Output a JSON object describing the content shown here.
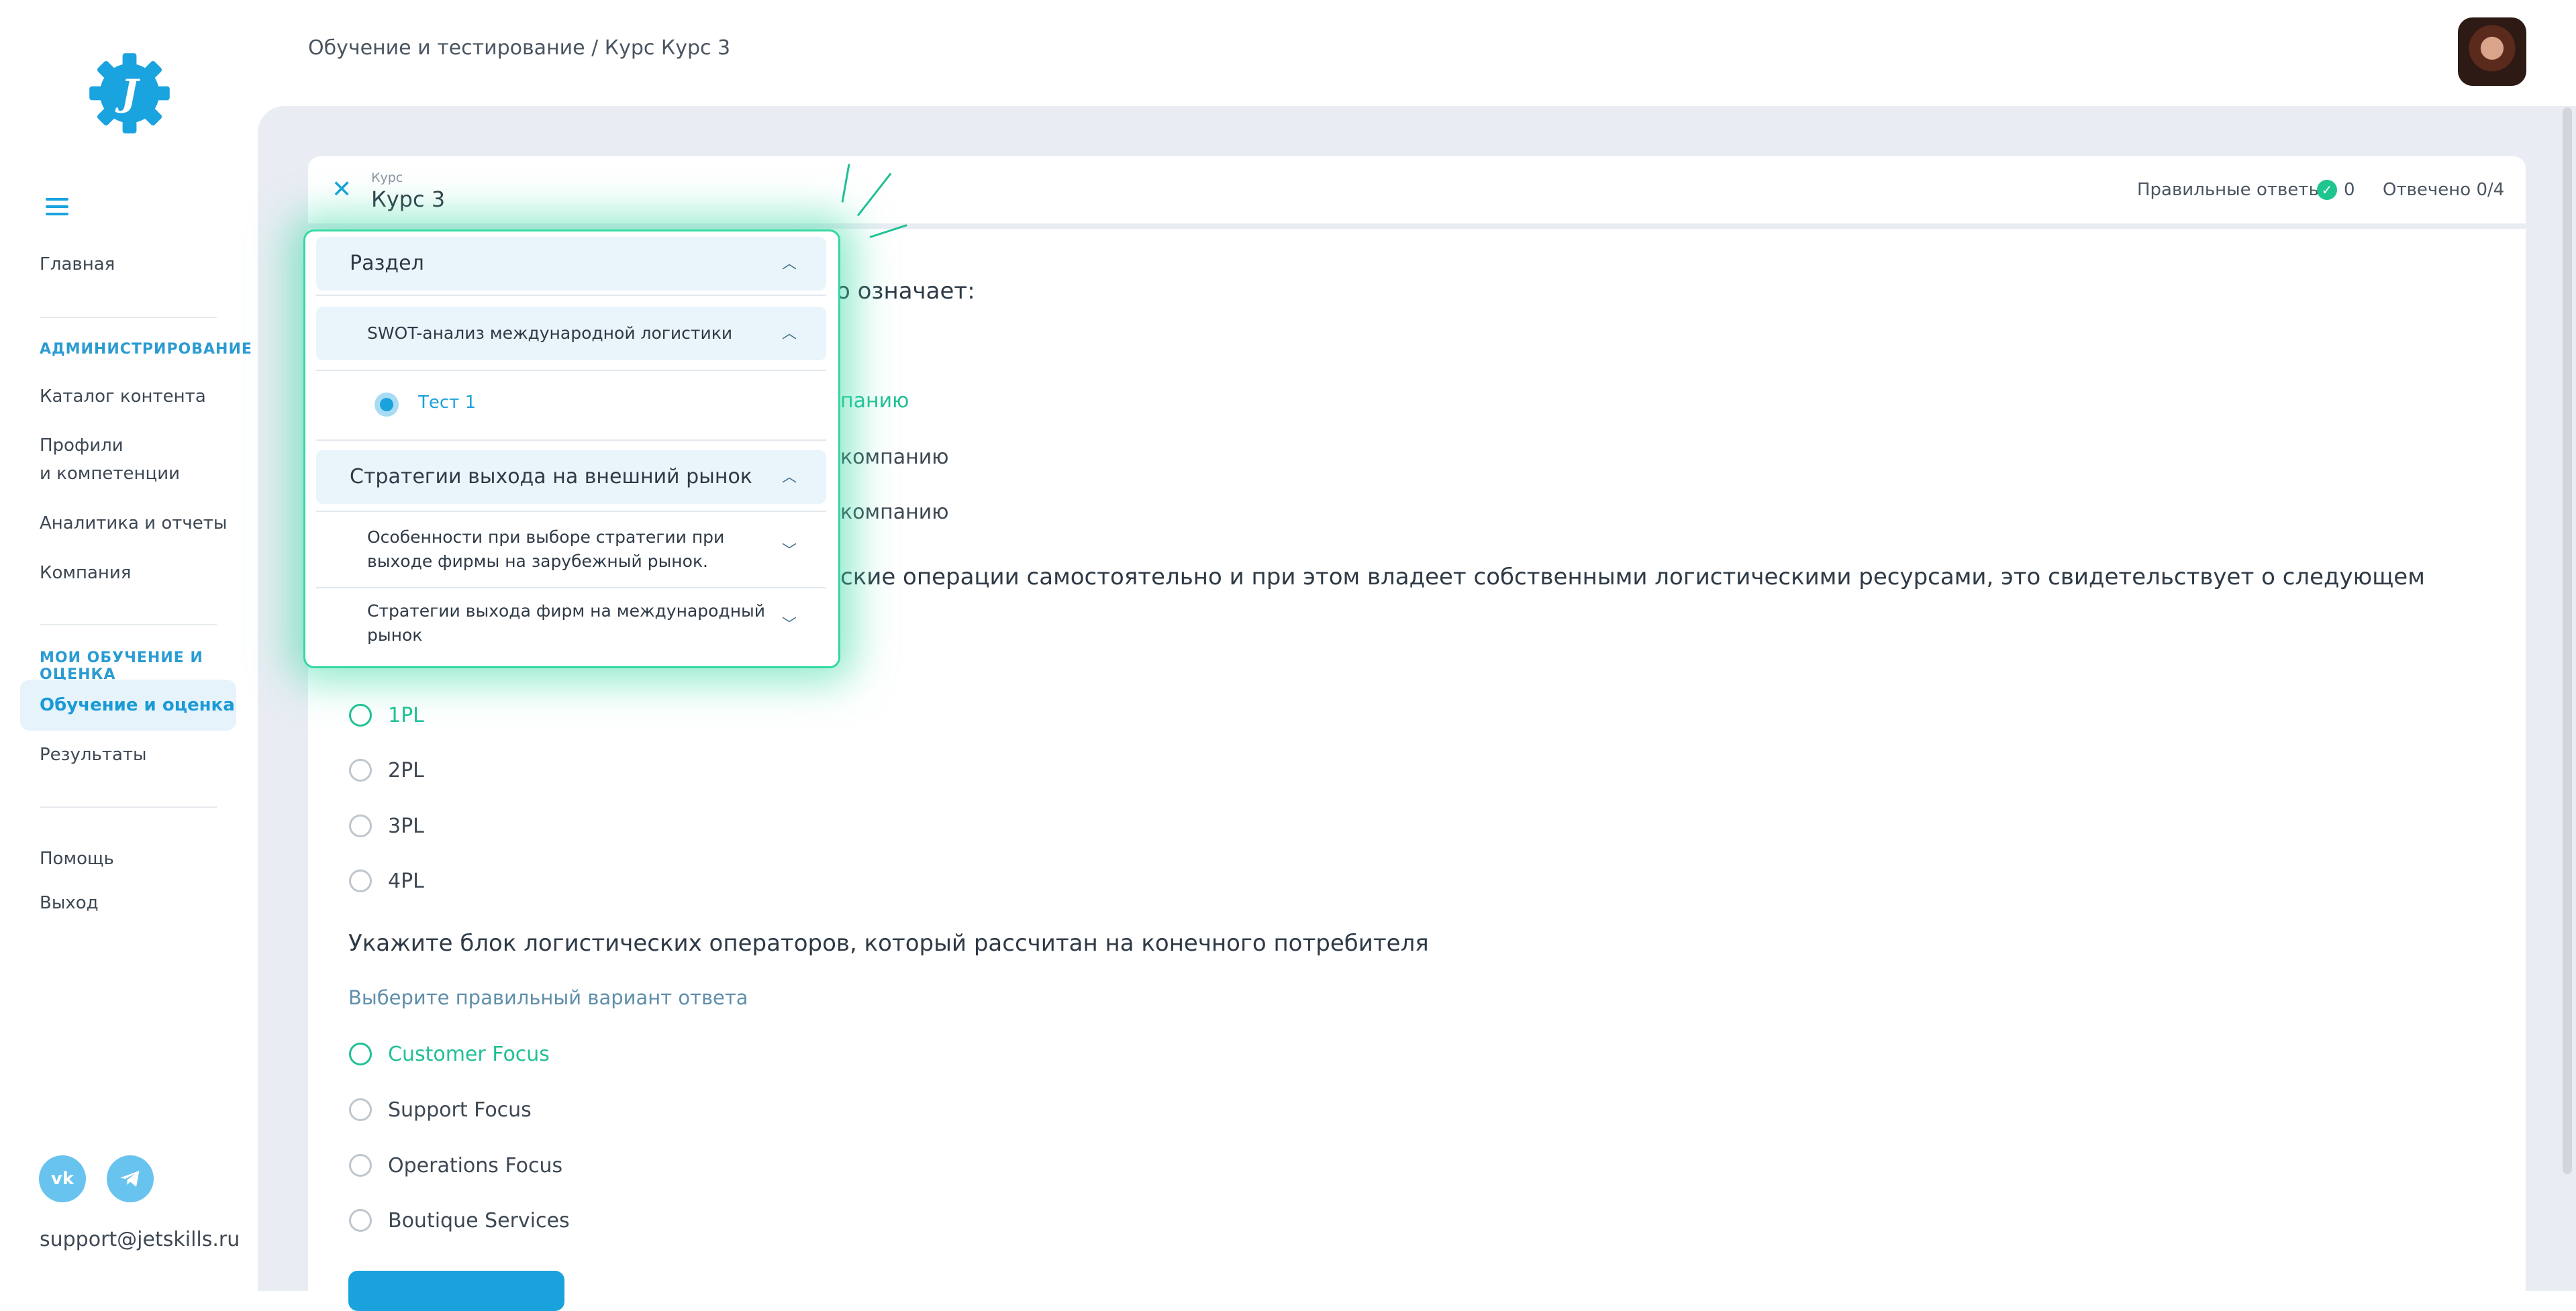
{
  "sidebar": {
    "logo_letter": "J",
    "nav_main": "Главная",
    "section_admin": "АДМИНИСТРИРОВАНИЕ",
    "admin_items": [
      "Каталог контента",
      "Профили",
      "и компетенции",
      "Аналитика и отчеты",
      "Компания"
    ],
    "section_learning": "МОИ ОБУЧЕНИЕ И ОЦЕНКА",
    "learning_items": [
      "Обучение и оценка",
      "Результаты"
    ],
    "bottom_items": [
      "Помощь",
      "Выход"
    ],
    "social": [
      "vk",
      "telegram"
    ],
    "support_email": "support@jetskills.ru",
    "accent_color": "#19a3df"
  },
  "header": {
    "breadcrumb": "Обучение и тестирование / Курс Курс 3"
  },
  "course": {
    "label_small": "Курс",
    "title": "Курс 3",
    "correct_label": "Правильные ответы",
    "correct_count": "0",
    "answered": "Отвечено 0/4"
  },
  "questions": {
    "q1_partial": "о означает:",
    "q1_options_partial": [
      "панию",
      "компанию",
      "компанию"
    ],
    "q2_partial": "ские операции самостоятельно и при этом владеет собственными логистическими ресурсами, это свидетельствует о следующем",
    "q2_options": [
      "1PL",
      "2PL",
      "3PL",
      "4PL"
    ],
    "q3_text": "Укажите блок логистических операторов, который рассчитан на конечного потребителя",
    "q3_hint": "Выберите правильный вариант ответа",
    "q3_options": [
      "Customer Focus",
      "Support Focus",
      "Operations Focus",
      "Boutique Services"
    ]
  },
  "panel": {
    "section_title": "Раздел",
    "sub1": "SWOT-анализ международной логистики",
    "sub1_item": "Тест 1",
    "section2": "Стратегии выхода на внешний рынок",
    "sub2_line1": "Особенности при выборе стратегии при",
    "sub2_line2": "выходе фирмы на зарубежный рынок.",
    "sub3_line1": "Стратегии выхода фирм на международный",
    "sub3_line2": "рынок"
  }
}
